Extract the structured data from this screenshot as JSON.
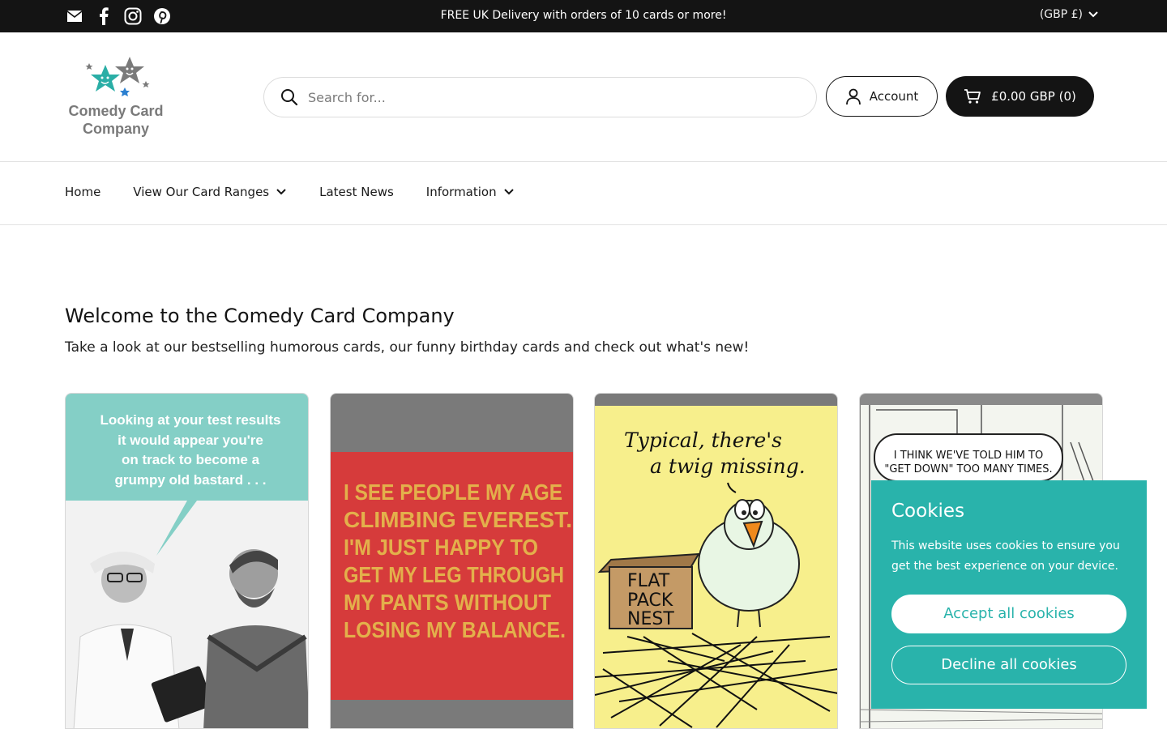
{
  "topbar": {
    "announcement": "FREE UK Delivery with orders of 10 cards or more!",
    "currency": "(GBP £)",
    "social_icons": [
      "email-icon",
      "facebook-icon",
      "instagram-icon",
      "pinterest-icon"
    ]
  },
  "header": {
    "logo_line1": "Comedy Card",
    "logo_line2": "Company",
    "search_placeholder": "Search for...",
    "account_label": "Account",
    "cart_label": "£0.00 GBP (0)"
  },
  "nav": {
    "items": [
      {
        "label": "Home",
        "dropdown": false
      },
      {
        "label": "View Our Card Ranges",
        "dropdown": true
      },
      {
        "label": "Latest News",
        "dropdown": false
      },
      {
        "label": "Information",
        "dropdown": true
      }
    ]
  },
  "welcome": {
    "title": "Welcome to the Comedy Card Company",
    "subtitle": "Take a look at our bestselling humorous cards, our funny birthday cards and check out what's new!"
  },
  "products": [
    {
      "text_lines": [
        "Looking at your test results",
        "it would appear you're",
        "on track to become a",
        "grumpy old bastard . . ."
      ]
    },
    {
      "text_lines": [
        "I SEE PEOPLE MY AGE",
        "CLIMBING EVEREST.",
        "I'M JUST HAPPY TO",
        "GET MY LEG THROUGH",
        "MY PANTS WITHOUT",
        "LOSING MY BALANCE."
      ]
    },
    {
      "text_lines": [
        "Typical, there's",
        "a twig missing."
      ],
      "box_lines": [
        "FLAT",
        "PACK",
        "NEST"
      ]
    },
    {
      "text_lines": [
        "I THINK WE'VE TOLD HIM TO",
        "\"GET DOWN\" TOO MANY TIMES."
      ]
    }
  ],
  "cookies": {
    "title": "Cookies",
    "message": "This website uses cookies to ensure you get the best experience on your device.",
    "accept_label": "Accept all cookies",
    "decline_label": "Decline all cookies"
  },
  "colors": {
    "topbar_bg": "#141414",
    "cookie_bg": "#29b3ab",
    "logo_teal": "#2aaea6",
    "card_red": "#d63b3b",
    "card_yellow": "#f7ef8c"
  }
}
